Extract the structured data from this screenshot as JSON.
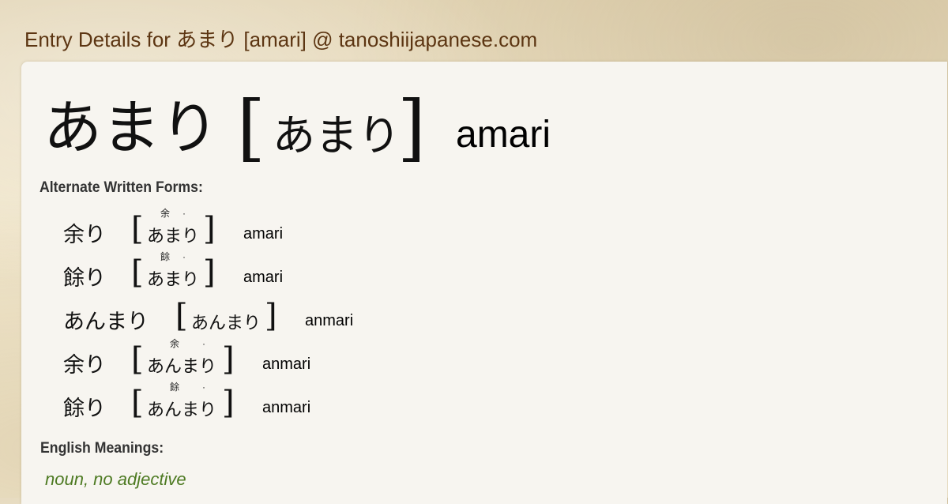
{
  "page": {
    "title": "Entry Details for あまり [amari] @ tanoshiijapanese.com"
  },
  "entry": {
    "word": "あまり",
    "bracket_open": "[",
    "bracket_close": "]",
    "reading": "あまり",
    "romaji": "amari"
  },
  "alternates": {
    "heading": "Alternate Written Forms:",
    "forms": [
      {
        "word": "余り",
        "reading": "あまり",
        "ruby": "余",
        "accent": "·",
        "romaji": "amari"
      },
      {
        "word": "餘り",
        "reading": "あまり",
        "ruby": "餘",
        "accent": "·",
        "romaji": "amari"
      },
      {
        "word": "あんまり",
        "reading": "あんまり",
        "ruby": "",
        "accent": "",
        "romaji": "anmari"
      },
      {
        "word": "余り",
        "reading": "あんまり",
        "ruby": "余",
        "accent": "·",
        "romaji": "anmari"
      },
      {
        "word": "餘り",
        "reading": "あんまり",
        "ruby": "餘",
        "accent": "·",
        "romaji": "anmari"
      }
    ]
  },
  "meanings": {
    "heading": "English Meanings:",
    "part_of_speech": "noun, no adjective"
  }
}
